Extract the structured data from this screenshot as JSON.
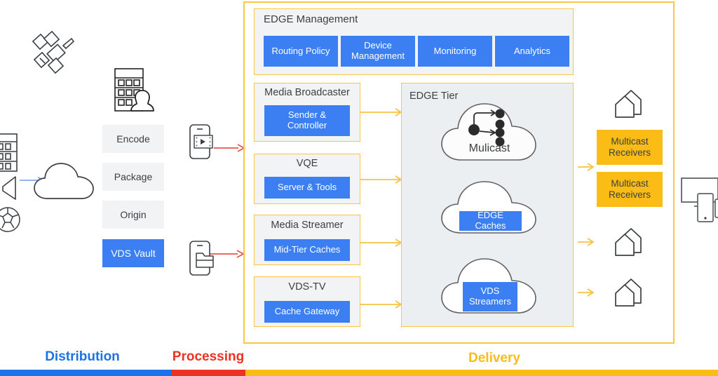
{
  "diagram": {
    "title_hidden": "",
    "colors": {
      "blue": "#3b7ff2",
      "yellow": "#fbbc15",
      "yellow_border": "#fbc641",
      "red": "#ea3323",
      "grey_panel": "#f1f3f4",
      "edge_panel": "#eceff1",
      "text": "#3c4043",
      "arrow_yellow": "#f5c344",
      "arrow_red": "#e8564a",
      "arrow_blue": "#6f9bea"
    }
  },
  "sources": {
    "satellite_icon": "satellite-icon",
    "building_icon": "building-icon",
    "megaphone_icon": "megaphone-icon",
    "soccer_icon": "soccer-ball-icon",
    "cloud_icon": "cloud-icon",
    "broadcaster_icon": "building-with-person-icon"
  },
  "processing": {
    "steps": [
      {
        "label": "Encode",
        "style": "grey"
      },
      {
        "label": "Package",
        "style": "grey"
      },
      {
        "label": "Origin",
        "style": "grey"
      },
      {
        "label": "VDS Vault",
        "style": "blue"
      }
    ]
  },
  "devices": {
    "phone_video_icon": "phone-video-icon",
    "phone_folder_icon": "phone-folder-icon"
  },
  "edge_management": {
    "title": "EDGE Management",
    "items": [
      {
        "label": "Routing Policy"
      },
      {
        "label": "Device\nManagement",
        "line1": "Device",
        "line2": "Management"
      },
      {
        "label": "Monitoring"
      },
      {
        "label": "Analytics"
      }
    ]
  },
  "functions": [
    {
      "title": "Media Broadcaster",
      "box_line1": "Sender &",
      "box_line2": "Controller"
    },
    {
      "title": "VQE",
      "box_line1": "Server & Tools",
      "box_line2": ""
    },
    {
      "title": "Media Streamer",
      "box_line1": "Mid-Tier Caches",
      "box_line2": ""
    },
    {
      "title": "VDS-TV",
      "box_line1": "Cache Gateway",
      "box_line2": ""
    }
  ],
  "edge_tier": {
    "title": "EDGE Tier",
    "clouds": [
      {
        "label": "Mulicast",
        "label_style": "plain",
        "icon": "multicast-tree-icon"
      },
      {
        "label": "EDGE Caches",
        "label_style": "blue",
        "icon": ""
      },
      {
        "label": "VDS",
        "label_line2": "Streamers",
        "label_style": "blue",
        "icon": ""
      }
    ]
  },
  "receivers": {
    "items": [
      {
        "type": "house",
        "icon": "houses-icon"
      },
      {
        "type": "box",
        "line1": "Multicast",
        "line2": "Receivers"
      },
      {
        "type": "box",
        "line1": "Multicast",
        "line2": "Receivers"
      },
      {
        "type": "house",
        "icon": "houses-icon"
      },
      {
        "type": "house",
        "icon": "houses-icon"
      }
    ]
  },
  "endpoint": {
    "monitor_icon": "monitor-icon",
    "phone_icon": "phone-icon"
  },
  "legend": {
    "items": [
      {
        "label": "Distribution",
        "color": "#1a73e8"
      },
      {
        "label": "Processing",
        "color": "#ea3323"
      },
      {
        "label": "Delivery",
        "color": "#fbbc15"
      }
    ]
  }
}
